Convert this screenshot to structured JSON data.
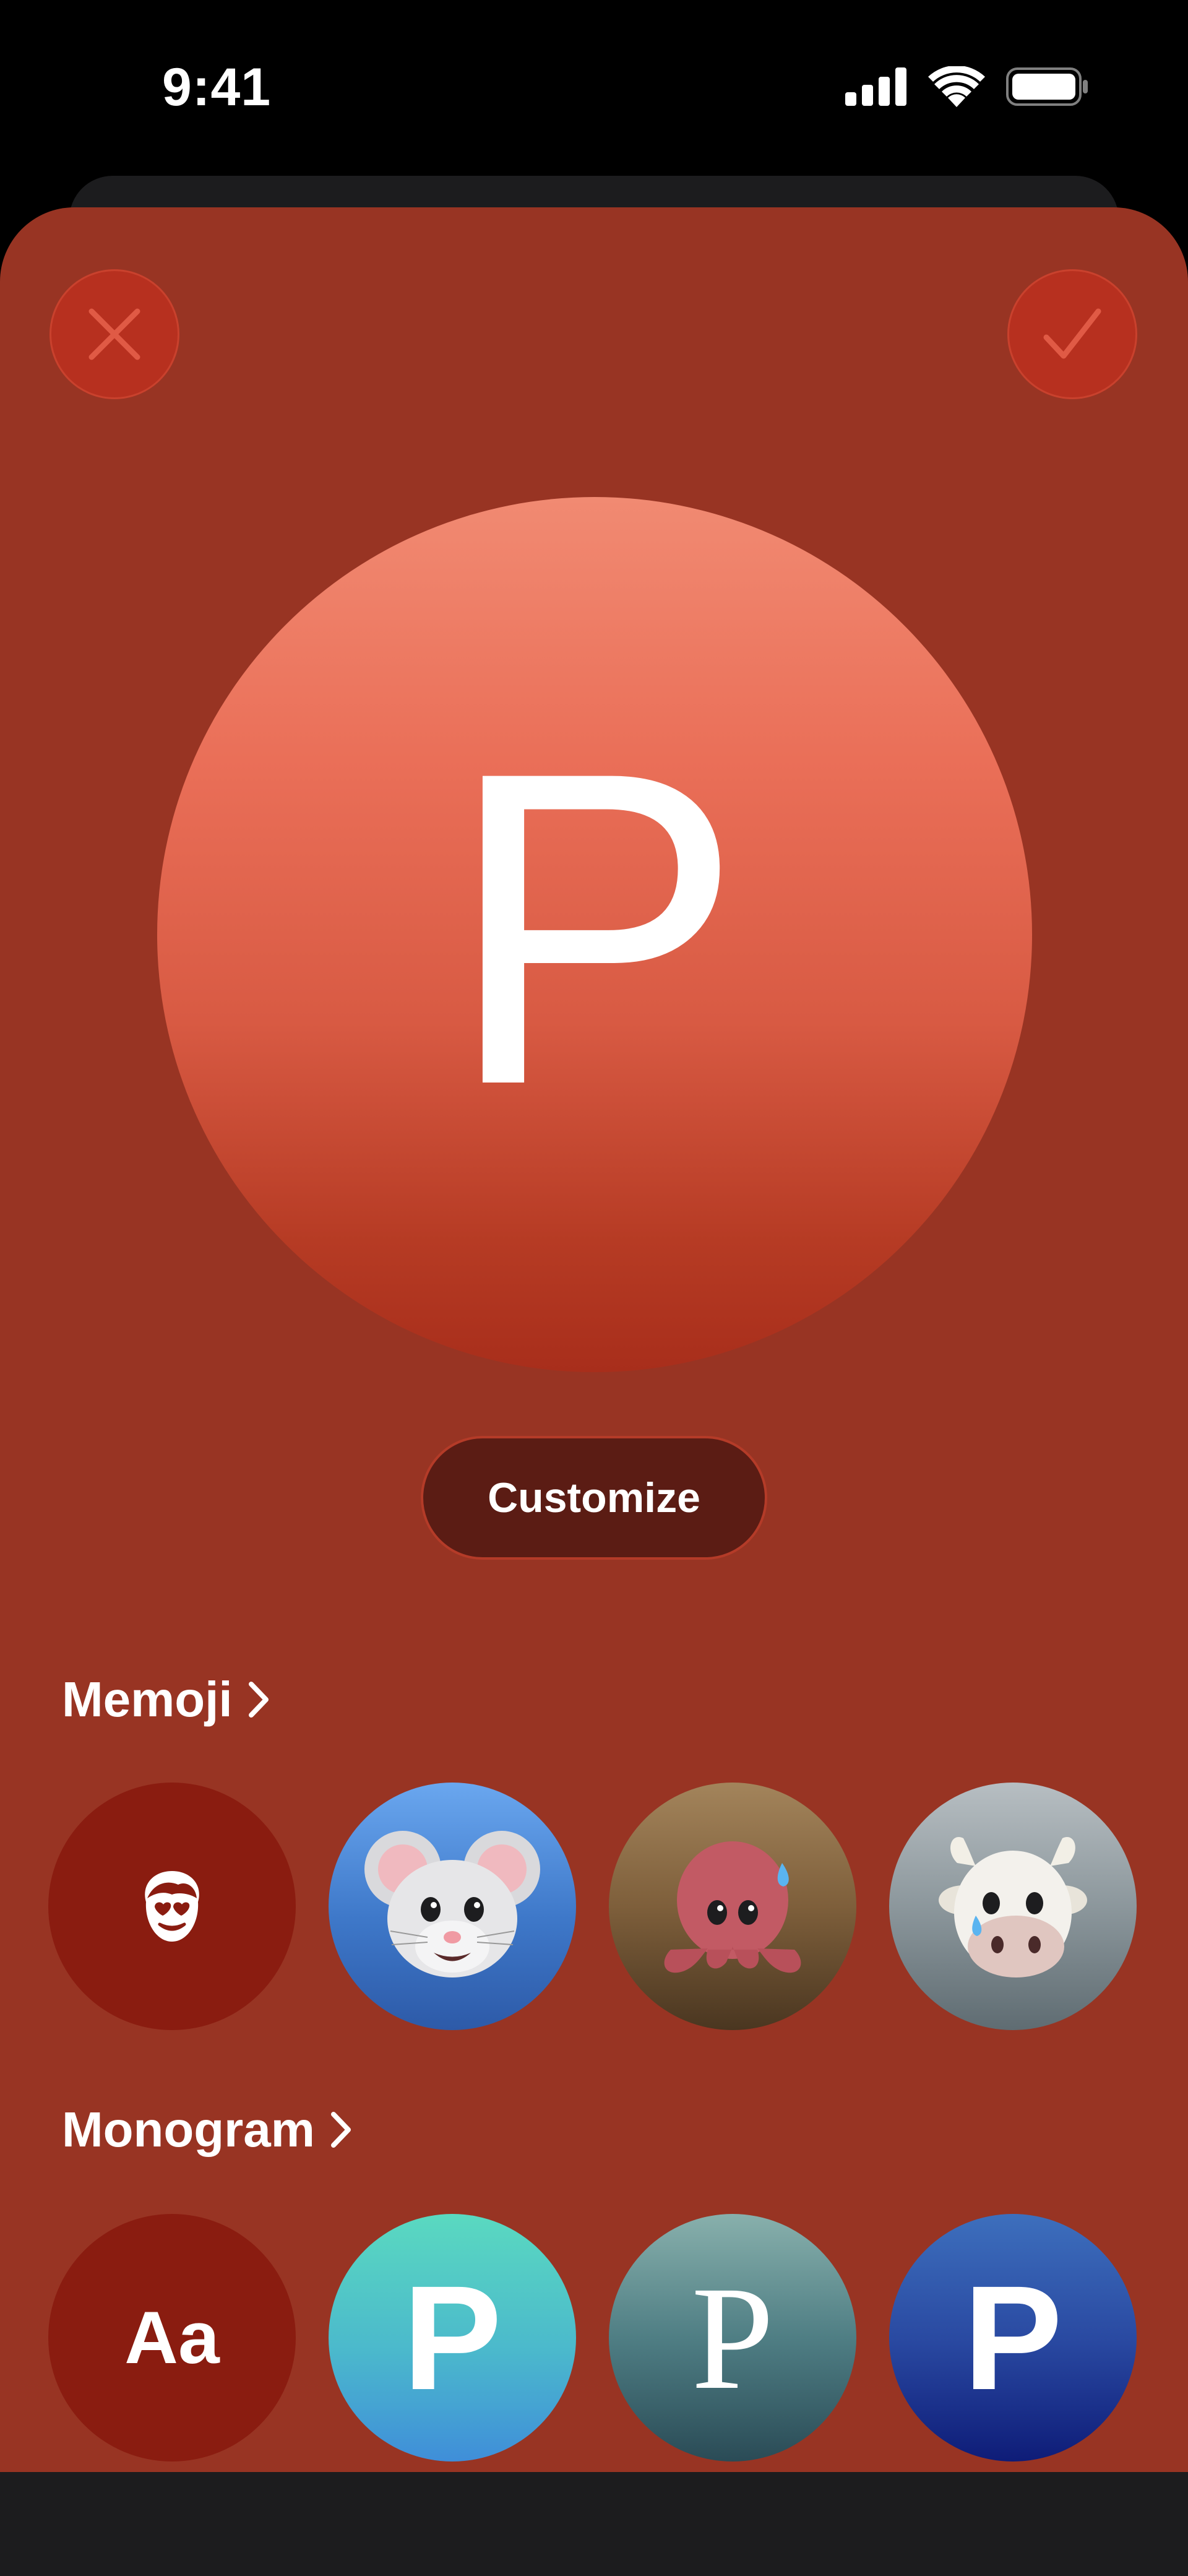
{
  "status_bar": {
    "time": "9:41",
    "icons": [
      "cellular-signal-icon",
      "wifi-icon",
      "battery-icon"
    ]
  },
  "sheet": {
    "background_color": "#983423",
    "close_icon": "close-icon",
    "done_icon": "checkmark-icon"
  },
  "avatar": {
    "letter": "P"
  },
  "customize_label": "Customize",
  "memoji": {
    "title": "Memoji",
    "items": [
      {
        "name": "memoji-create-icon"
      },
      {
        "name": "mouse-memoji"
      },
      {
        "name": "octopus-memoji"
      },
      {
        "name": "cow-memoji"
      }
    ]
  },
  "monogram": {
    "title": "Monogram",
    "items": [
      {
        "label": "Aa"
      },
      {
        "label": "P",
        "style": "sans"
      },
      {
        "label": "P",
        "style": "serif"
      },
      {
        "label": "P",
        "style": "sans"
      }
    ]
  }
}
